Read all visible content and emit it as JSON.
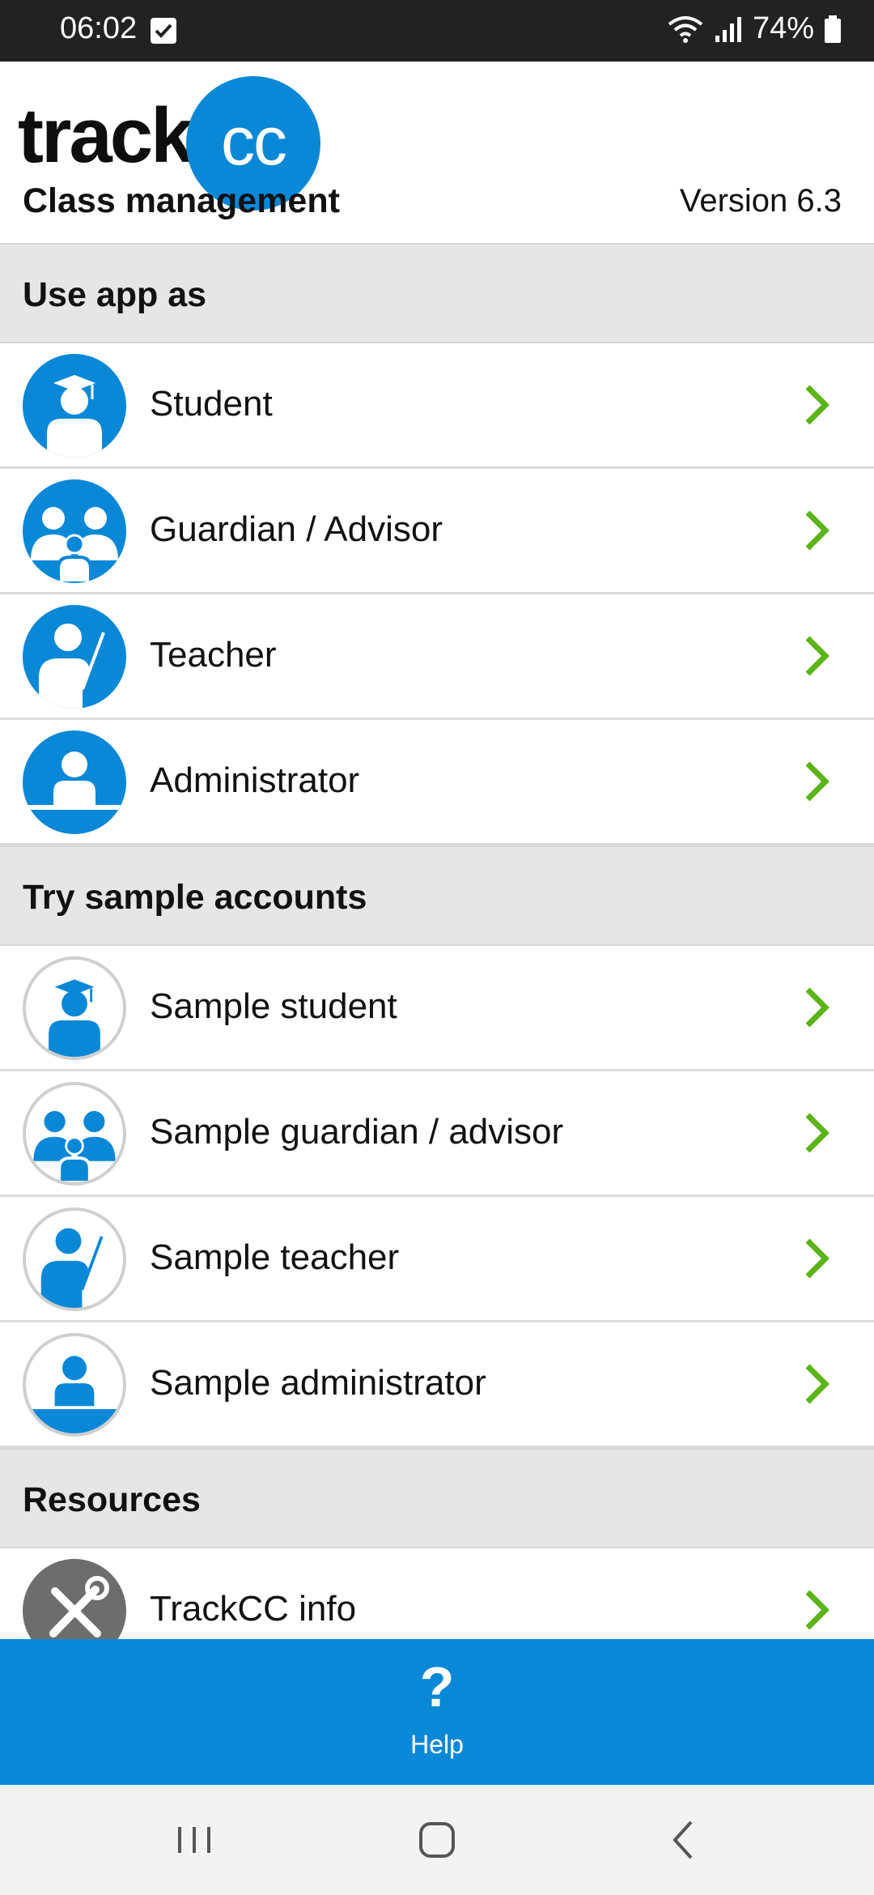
{
  "status_bar": {
    "time": "06:02",
    "battery": "74%"
  },
  "header": {
    "logo_text": "track",
    "logo_circle_text": "cc",
    "title": "Class management",
    "version": "Version 6.3"
  },
  "sections": {
    "use_app_as": "Use app as",
    "try_sample": "Try sample accounts",
    "resources": "Resources"
  },
  "roles": [
    {
      "label": "Student",
      "icon": "student-icon"
    },
    {
      "label": "Guardian / Advisor",
      "icon": "guardian-icon"
    },
    {
      "label": "Teacher",
      "icon": "teacher-icon"
    },
    {
      "label": "Administrator",
      "icon": "administrator-icon"
    }
  ],
  "samples": [
    {
      "label": "Sample student",
      "icon": "student-icon"
    },
    {
      "label": "Sample guardian / advisor",
      "icon": "guardian-icon"
    },
    {
      "label": "Sample teacher",
      "icon": "teacher-icon"
    },
    {
      "label": "Sample administrator",
      "icon": "administrator-icon"
    }
  ],
  "resources": [
    {
      "label": "TrackCC info",
      "icon": "tools-icon"
    }
  ],
  "help": {
    "icon_text": "?",
    "label": "Help"
  },
  "colors": {
    "brand_blue": "#0a88d8",
    "chevron_green": "#5bb418",
    "section_bg": "#e6e6e6"
  }
}
